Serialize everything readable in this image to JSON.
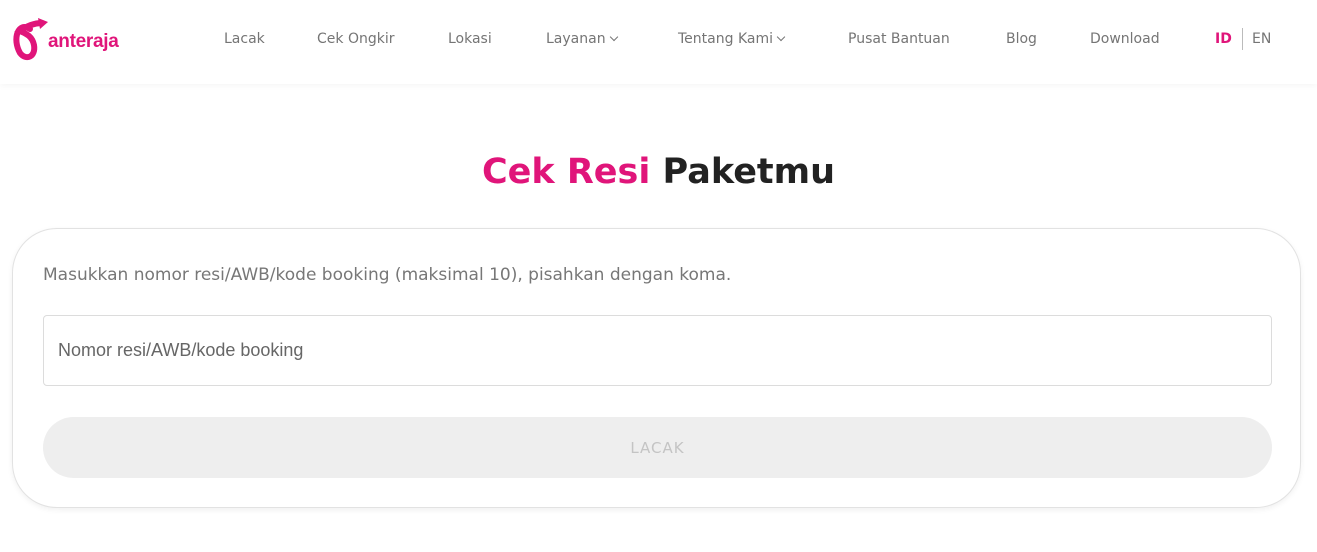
{
  "brand": {
    "name": "anteraja",
    "color": "#e0157a"
  },
  "nav": {
    "items": [
      {
        "label": "Lacak"
      },
      {
        "label": "Cek Ongkir"
      },
      {
        "label": "Lokasi"
      },
      {
        "label": "Layanan",
        "dropdown": true
      },
      {
        "label": "Tentang Kami",
        "dropdown": true
      },
      {
        "label": "Pusat Bantuan"
      },
      {
        "label": "Blog"
      },
      {
        "label": "Download"
      }
    ],
    "lang": {
      "active": "ID",
      "other": "EN"
    }
  },
  "main": {
    "title_highlight": "Cek Resi",
    "title_rest": "Paketmu",
    "hint": "Masukkan nomor resi/AWB/kode booking (maksimal 10), pisahkan dengan koma.",
    "input": {
      "value": "",
      "placeholder": "Nomor resi/AWB/kode booking"
    },
    "button_label": "LACAK"
  }
}
